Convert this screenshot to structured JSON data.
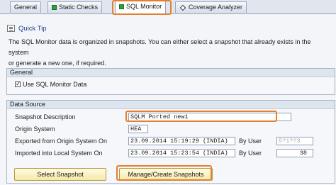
{
  "tabs": [
    {
      "label": "General",
      "icon": "none"
    },
    {
      "label": "Static Checks",
      "icon": "green-square-icon"
    },
    {
      "label": "SQL Monitor",
      "icon": "green-square-icon"
    },
    {
      "label": "Coverage Analyzer",
      "icon": "diamond-icon"
    }
  ],
  "quick_tip": {
    "title": "Quick Tip",
    "line1": "The SQL Monitor data is organized in snapshots. You can either select a snapshot that already exists in the system",
    "line2": "or generate a new one, if required."
  },
  "general_group": {
    "title": "General",
    "use_sql_monitor_label": "Use SQL Monitor Data",
    "use_sql_monitor_checked": true
  },
  "data_source": {
    "title": "Data Source",
    "snapshot_description_label": "Snapshot Description",
    "snapshot_description_value": "SQLM Ported new1",
    "origin_system_label": "Origin System",
    "origin_system_value": "HEA",
    "exported_label": "Exported from Origin System On",
    "exported_value": "23.09.2014 15:19:29 (INDIA)",
    "exported_by_label": "By User",
    "exported_by_value": "5?1??3",
    "imported_label": "Imported into Local System On",
    "imported_value": "23.09.2014 15:23:54 (INDIA)",
    "imported_by_label": "By User",
    "imported_by_value": "38"
  },
  "buttons": {
    "select_snapshot": "Select Snapshot",
    "manage_snapshots": "Manage/Create Snapshots"
  },
  "colors": {
    "highlight": "#e57f2e",
    "button_fill": "#f6e9a6",
    "tab_icon_green": "#2ea043"
  }
}
